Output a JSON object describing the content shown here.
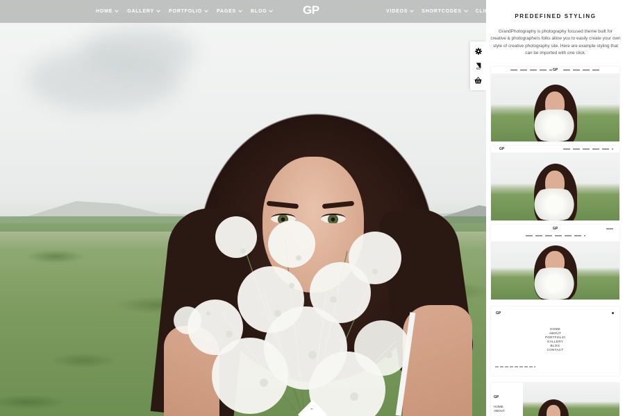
{
  "nav": {
    "logo": "GP",
    "left_items": [
      {
        "label": "HOME"
      },
      {
        "label": "GALLERY"
      },
      {
        "label": "PORTFOLIO"
      },
      {
        "label": "PAGES"
      },
      {
        "label": "BLOG"
      }
    ],
    "right_items": [
      {
        "label": "VIDEOS"
      },
      {
        "label": "SHORTCODES"
      },
      {
        "label": "CLIENT LOG"
      }
    ]
  },
  "tools": [
    {
      "icon": "gear-icon",
      "glyph": "⚙"
    },
    {
      "icon": "book-icon",
      "glyph": "▮"
    },
    {
      "icon": "basket-icon",
      "glyph": "▣"
    }
  ],
  "panel": {
    "title": "PREDEFINED STYLING",
    "description": "GrandPhotography is photography focused theme built for creative & photographers folks allow you to easily create your own style of creative photography site. Here are example styling that can be imported with one click.",
    "thumbs": [
      {
        "logo": "GP"
      },
      {
        "logo": "GP"
      },
      {
        "logo": "GP"
      },
      {
        "logo": "GP",
        "menu": [
          "HOME",
          "ABOUT",
          "PORTFOLIO",
          "GALLERY",
          "BLOG",
          "CONTACT"
        ]
      },
      {
        "logo": "GP",
        "menu": [
          "HOME",
          "ABOUT"
        ]
      }
    ]
  },
  "scroll_down_glyph": "⌃"
}
